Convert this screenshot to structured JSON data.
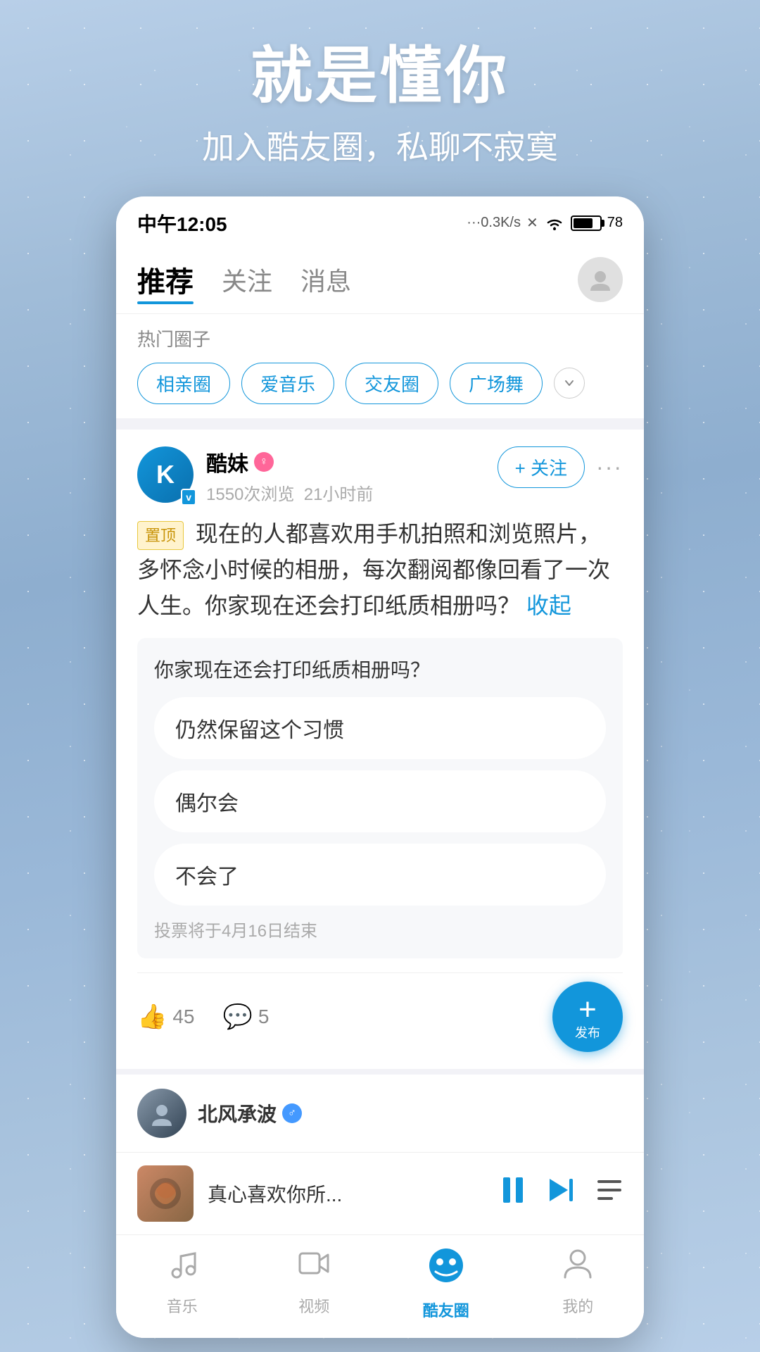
{
  "hero": {
    "title": "就是懂你",
    "subtitle": "加入酷友圈，私聊不寂寞"
  },
  "statusBar": {
    "time": "中午12:05",
    "signal": "···0.3K/s",
    "battery": "78"
  },
  "navTabs": {
    "tabs": [
      {
        "label": "推荐",
        "active": true
      },
      {
        "label": "关注",
        "active": false
      },
      {
        "label": "消息",
        "active": false
      }
    ]
  },
  "hotSection": {
    "title": "热门圈子",
    "tags": [
      "相亲圈",
      "爱音乐",
      "交友圈",
      "广场舞"
    ]
  },
  "post": {
    "username": "酷妹",
    "avatarLetter": "K",
    "views": "1550次浏览",
    "timeAgo": "21小时前",
    "followLabel": "+ 关注",
    "pinnedTag": "置顶",
    "content": "现在的人都喜欢用手机拍照和浏览照片，多怀念小时候的相册，每次翻阅都像回看了一次人生。你家现在还会打印纸质相册吗？",
    "collapseLabel": "收起",
    "poll": {
      "question": "你家现在还会打印纸质相册吗？",
      "options": [
        "仍然保留这个习惯",
        "偶尔会",
        "不会了"
      ],
      "endText": "投票将于4月16日结束"
    },
    "likeCount": "45",
    "commentCount": "5",
    "fabLabel": "发布"
  },
  "nextPost": {
    "username": "北风承波",
    "avatarColor": "#445566"
  },
  "musicPlayer": {
    "title": "真心喜欢你所..."
  },
  "bottomNav": {
    "items": [
      {
        "label": "音乐",
        "icon": "♪",
        "active": false
      },
      {
        "label": "视频",
        "icon": "▶",
        "active": false
      },
      {
        "label": "酷友圈",
        "icon": "💬",
        "active": true
      },
      {
        "label": "我的",
        "icon": "👤",
        "active": false
      }
    ]
  }
}
